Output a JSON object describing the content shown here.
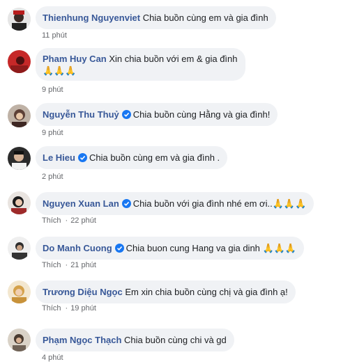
{
  "comments": [
    {
      "name": "Thienhung Nguyenviet",
      "verified": false,
      "text": "Chia buồn cùng em và gia đình",
      "time": "11 phút",
      "like": ""
    },
    {
      "name": "Pham Huy Can",
      "verified": false,
      "text": "Xin chia buồn với em & gia đình",
      "text2": "🙏🙏🙏",
      "time": "9 phút",
      "like": ""
    },
    {
      "name": "Nguyễn Thu Thuỷ",
      "verified": true,
      "text": "Chia buồn cùng Hằng và gia đình!",
      "time": "9 phút",
      "like": ""
    },
    {
      "name": "Le Hieu",
      "verified": true,
      "text": "Chia buồn cùng em và gia đình .",
      "time": "2 phút",
      "like": ""
    },
    {
      "name": "Nguyen Xuan Lan",
      "verified": true,
      "text": "Chia buồn với gia đình nhé em ơi..🙏🙏🙏",
      "time": "22 phút",
      "like": "Thích"
    },
    {
      "name": "Do Manh Cuong",
      "verified": true,
      "text": "Chia buon cung Hang va gia dinh 🙏🙏🙏",
      "time": "21 phút",
      "like": "Thích"
    },
    {
      "name": "Trương Diệu Ngọc",
      "verified": false,
      "text": "Em xin chia buồn cùng chị và gia đình ạ!",
      "time": "19 phút",
      "like": "Thích"
    },
    {
      "name": "Phạm Ngọc Thạch",
      "verified": false,
      "text": "Chia buồn cùng chi và gd",
      "time": "4 phút",
      "like": ""
    }
  ],
  "colors": {
    "name": "#385898",
    "bubble": "#f0f2f5",
    "verified": "#1877f2",
    "meta": "#65676b"
  }
}
